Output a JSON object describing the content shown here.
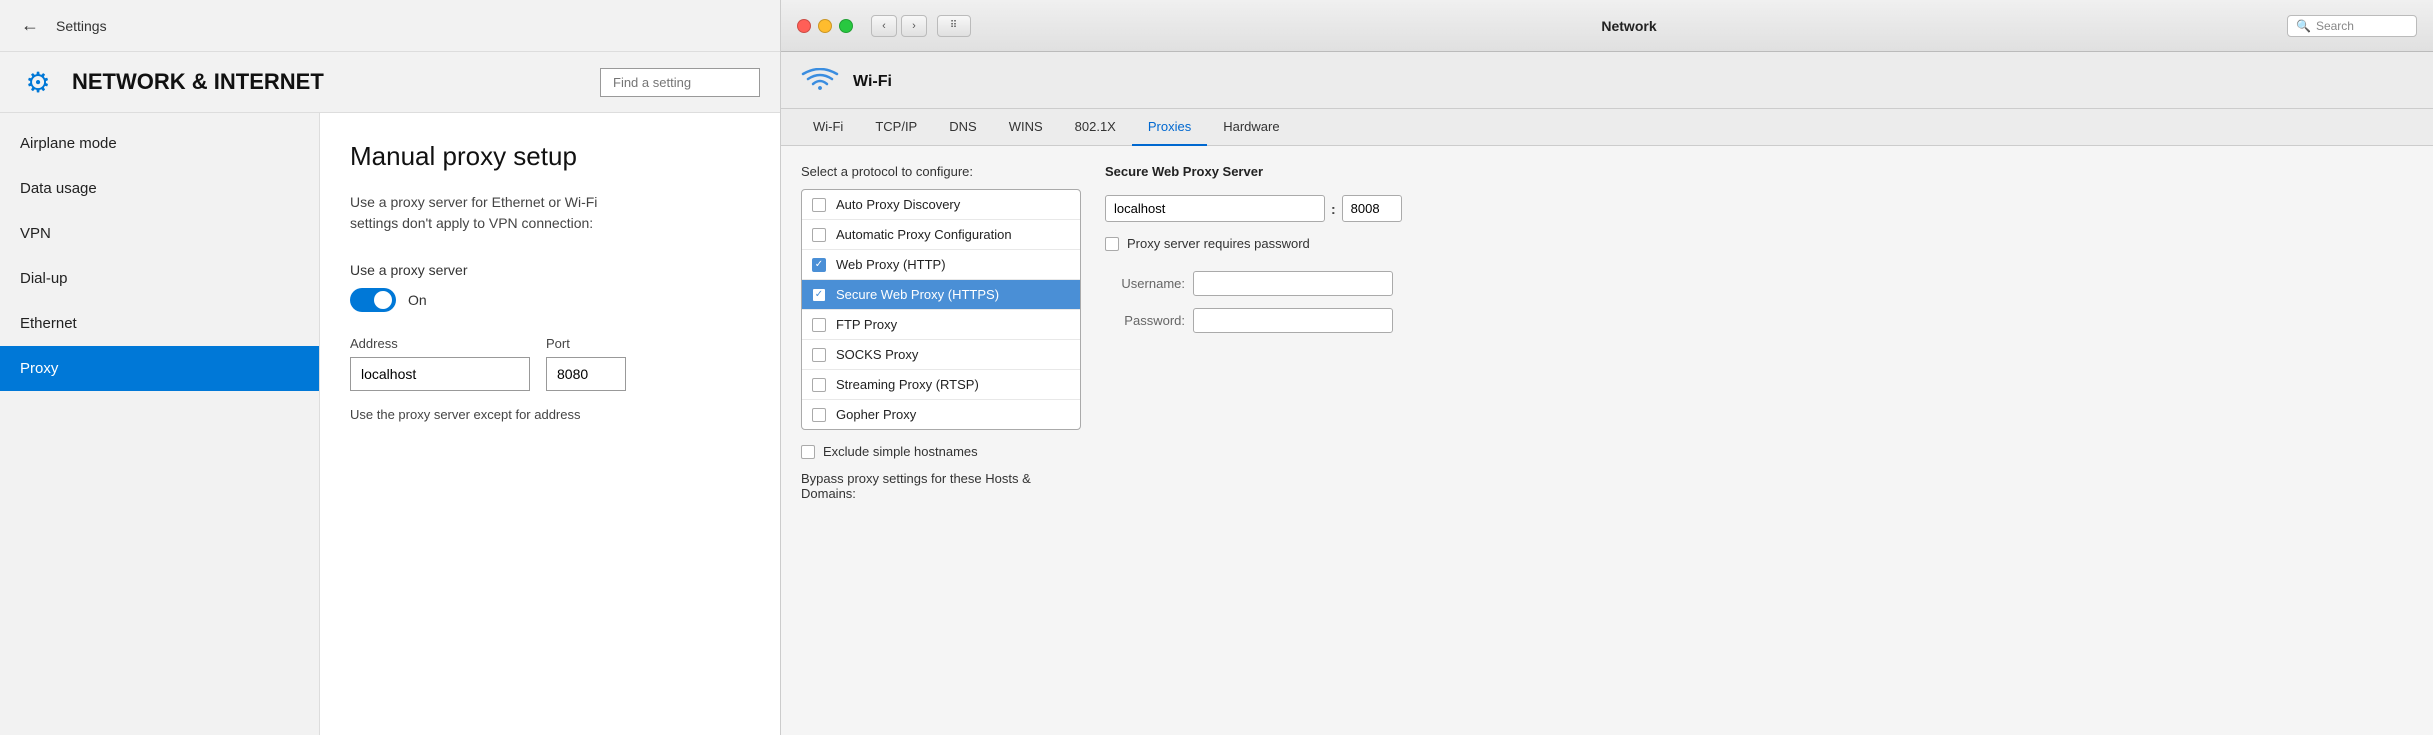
{
  "windows": {
    "titlebar": {
      "back_label": "←",
      "title": "Settings"
    },
    "header": {
      "icon": "⚙",
      "section_title": "NETWORK & INTERNET",
      "search_placeholder": "Find a setting"
    },
    "sidebar": {
      "items": [
        {
          "label": "Airplane mode",
          "active": false
        },
        {
          "label": "Data usage",
          "active": false
        },
        {
          "label": "VPN",
          "active": false
        },
        {
          "label": "Dial-up",
          "active": false
        },
        {
          "label": "Ethernet",
          "active": false
        },
        {
          "label": "Proxy",
          "active": true
        }
      ]
    },
    "main": {
      "title": "Manual proxy setup",
      "description_line1": "Use a proxy server for Ethernet or Wi-Fi",
      "description_line2": "settings don't apply to VPN connection:",
      "toggle_label": "Use a proxy server",
      "toggle_state": "On",
      "address_label": "Address",
      "address_value": "localhost",
      "port_label": "Port",
      "port_value": "8080",
      "footer_text": "Use the proxy server except for address"
    }
  },
  "mac": {
    "titlebar": {
      "title": "Network",
      "search_placeholder": "Search"
    },
    "traffic_lights": {
      "close": "close",
      "minimize": "minimize",
      "maximize": "maximize"
    },
    "nav": {
      "back": "‹",
      "forward": "›",
      "grid": "⠿"
    },
    "network_name": "Wi-Fi",
    "tabs": [
      {
        "label": "Wi-Fi",
        "active": false
      },
      {
        "label": "TCP/IP",
        "active": false
      },
      {
        "label": "DNS",
        "active": false
      },
      {
        "label": "WINS",
        "active": false
      },
      {
        "label": "802.1X",
        "active": false
      },
      {
        "label": "Proxies",
        "active": true
      },
      {
        "label": "Hardware",
        "active": false
      }
    ],
    "protocol_panel": {
      "label": "Select a protocol to configure:",
      "items": [
        {
          "label": "Auto Proxy Discovery",
          "checked": false,
          "selected": false
        },
        {
          "label": "Automatic Proxy Configuration",
          "checked": false,
          "selected": false
        },
        {
          "label": "Web Proxy (HTTP)",
          "checked": true,
          "selected": false
        },
        {
          "label": "Secure Web Proxy (HTTPS)",
          "checked": true,
          "selected": true
        },
        {
          "label": "FTP Proxy",
          "checked": false,
          "selected": false
        },
        {
          "label": "SOCKS Proxy",
          "checked": false,
          "selected": false
        },
        {
          "label": "Streaming Proxy (RTSP)",
          "checked": false,
          "selected": false
        },
        {
          "label": "Gopher Proxy",
          "checked": false,
          "selected": false
        }
      ],
      "exclude_simple_hostnames": "Exclude simple hostnames",
      "bypass_label": "Bypass proxy settings for these Hosts & Domains:"
    },
    "proxy_config": {
      "title": "Secure Web Proxy Server",
      "server_value": "localhost",
      "port_value": "8008",
      "password_check_label": "Proxy server requires password",
      "username_label": "Username:",
      "password_label": "Password:",
      "username_value": "",
      "password_value": ""
    }
  }
}
